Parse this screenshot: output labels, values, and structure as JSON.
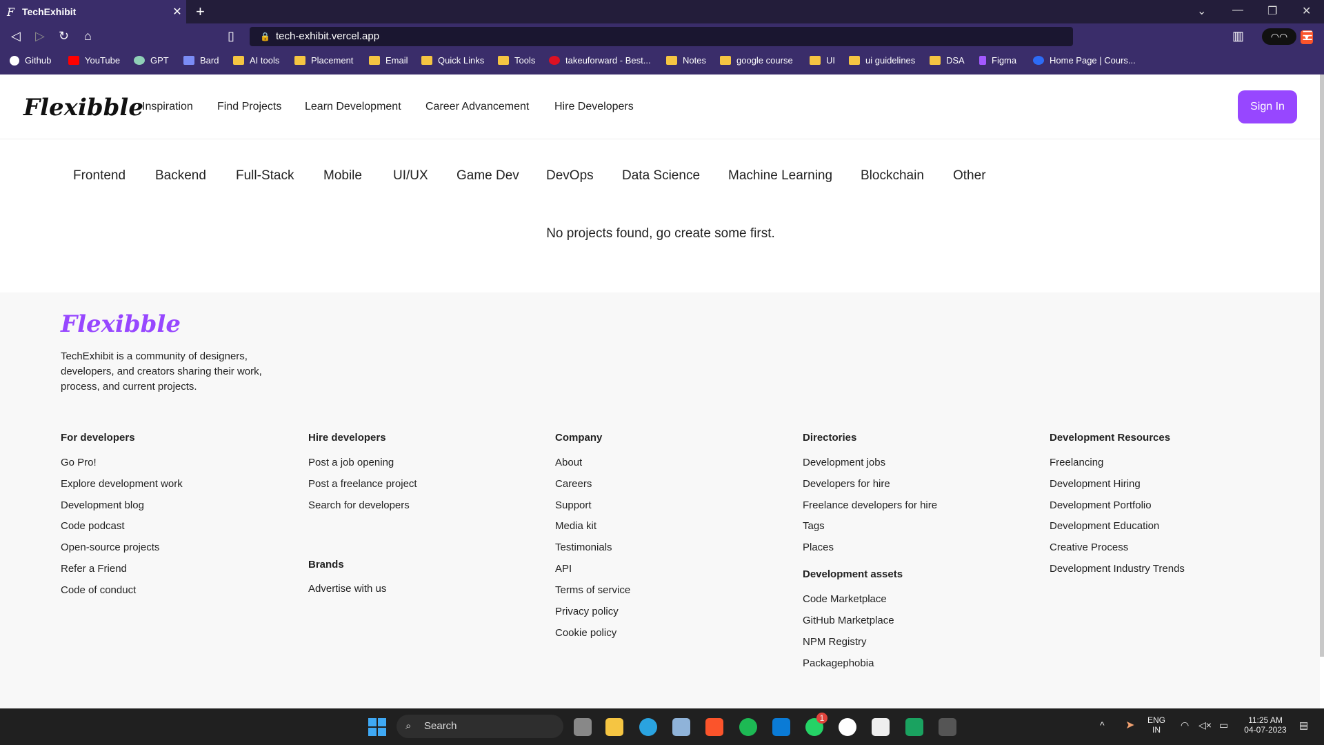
{
  "browser": {
    "tab_title": "TechExhibit",
    "url": "tech-exhibit.vercel.app",
    "bookmarks": [
      "Github",
      "YouTube",
      "GPT",
      "Bard",
      "AI tools",
      "Placement",
      "Email",
      "Quick Links",
      "Tools",
      "takeuforward - Best...",
      "Notes",
      "google course",
      "UI",
      "ui guidelines",
      "DSA",
      "Figma",
      "Home Page | Cours..."
    ]
  },
  "header": {
    "logo": "Flexibble",
    "nav": [
      "Inspiration",
      "Find Projects",
      "Learn Development",
      "Career Advancement",
      "Hire Developers"
    ],
    "signin_label": "Sign In"
  },
  "categories": [
    "Frontend",
    "Backend",
    "Full-Stack",
    "Mobile",
    "UI/UX",
    "Game Dev",
    "DevOps",
    "Data Science",
    "Machine Learning",
    "Blockchain",
    "Other"
  ],
  "empty_message": "No projects found, go create some first.",
  "footer": {
    "logo": "Flexibble",
    "description": "TechExhibit is a community of designers, developers, and creators sharing their work, process, and current projects.",
    "columns": [
      {
        "title": "For developers",
        "links": [
          "Go Pro!",
          "Explore development work",
          "Development blog",
          "Code podcast",
          "Open-source projects",
          "Refer a Friend",
          "Code of conduct"
        ]
      },
      {
        "title": "Hire developers",
        "links": [
          "Post a job opening",
          "Post a freelance project",
          "Search for developers"
        ]
      },
      {
        "title": "Brands",
        "links": [
          "Advertise with us"
        ]
      },
      {
        "title": "Company",
        "links": [
          "About",
          "Careers",
          "Support",
          "Media kit",
          "Testimonials",
          "API",
          "Terms of service",
          "Privacy policy",
          "Cookie policy"
        ]
      },
      {
        "title": "Directories",
        "links": [
          "Development jobs",
          "Developers for hire",
          "Freelance developers for hire",
          "Tags",
          "Places"
        ]
      },
      {
        "title": "Development assets",
        "links": [
          "Code Marketplace",
          "GitHub Marketplace",
          "NPM Registry",
          "Packagephobia"
        ]
      },
      {
        "title": "Development Resources",
        "links": [
          "Freelancing",
          "Development Hiring",
          "Development Portfolio",
          "Development Education",
          "Creative Process",
          "Development Industry Trends"
        ]
      }
    ]
  },
  "taskbar": {
    "search_placeholder": "Search",
    "lang": "ENG",
    "region": "IN",
    "time": "11:25 AM",
    "date": "04-07-2023",
    "whatsapp_badge": "1"
  },
  "colors": {
    "accent": "#9747ff",
    "chrome": "#3a2d6a",
    "taskbar": "#202020"
  }
}
